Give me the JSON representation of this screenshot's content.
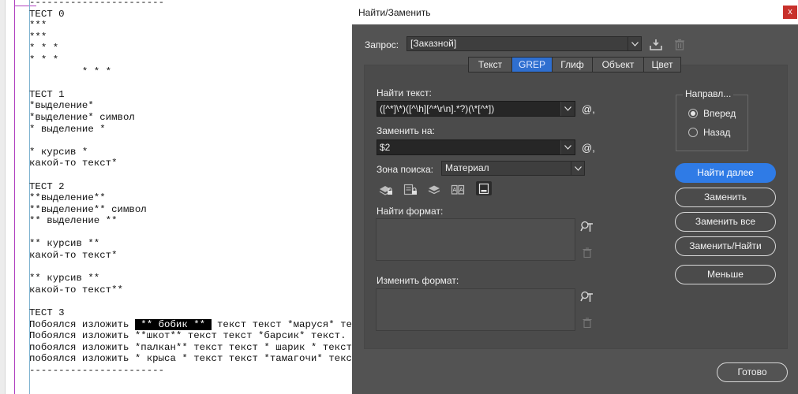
{
  "document": {
    "lines": [
      [
        {
          "t": "-----------------------"
        }
      ],
      [
        {
          "t": "ТЕСТ 0"
        }
      ],
      [
        {
          "t": "***"
        }
      ],
      [
        {
          "t": "***"
        }
      ],
      [
        {
          "t": "* * *"
        }
      ],
      [
        {
          "t": "* * *"
        }
      ],
      [
        {
          "t": "         * * *"
        }
      ],
      [
        {
          "t": ""
        }
      ],
      [
        {
          "t": "ТЕСТ 1"
        }
      ],
      [
        {
          "t": "*выделение*"
        }
      ],
      [
        {
          "t": "*выделение* символ"
        }
      ],
      [
        {
          "t": "* выделение *"
        }
      ],
      [
        {
          "t": ""
        }
      ],
      [
        {
          "t": "* курсив *"
        }
      ],
      [
        {
          "t": "какой-то текст*"
        }
      ],
      [
        {
          "t": ""
        }
      ],
      [
        {
          "t": "ТЕСТ 2"
        }
      ],
      [
        {
          "t": "**выделение**"
        }
      ],
      [
        {
          "t": "**выделение** символ"
        }
      ],
      [
        {
          "t": "** выделение **"
        }
      ],
      [
        {
          "t": ""
        }
      ],
      [
        {
          "t": "** курсив **"
        }
      ],
      [
        {
          "t": "какой-то текст*"
        }
      ],
      [
        {
          "t": ""
        }
      ],
      [
        {
          "t": "** курсив **"
        }
      ],
      [
        {
          "t": "какой-то текст**"
        }
      ],
      [
        {
          "t": ""
        }
      ],
      [
        {
          "t": "ТЕСТ 3"
        }
      ],
      [
        {
          "t": "Побоялся изложить "
        },
        {
          "t": " ** бобик ** ",
          "sel": true
        },
        {
          "t": " текст текст *маруся* текст."
        }
      ],
      [
        {
          "t": "Побоялся изложить **шкот** текст текст *барсик* текст."
        }
      ],
      [
        {
          "t": "побоялся изложить *палкан** текст текст * шарик * текст."
        }
      ],
      [
        {
          "t": "побоялся изложить * крыса * текст текст *тамагочи* текст."
        }
      ],
      [
        {
          "t": "-----------------------"
        }
      ]
    ]
  },
  "dialog": {
    "title": "Найти/Заменить",
    "close_glyph": "x",
    "query": {
      "label": "Запрос:",
      "value": "[Заказной]",
      "icons": [
        "save-query-icon",
        "delete-query-icon"
      ]
    },
    "tabs": [
      {
        "label": "Текст",
        "active": false
      },
      {
        "label": "GREP",
        "active": true
      },
      {
        "label": "Глиф",
        "active": false
      },
      {
        "label": "Объект",
        "active": false
      },
      {
        "label": "Цвет",
        "active": false
      }
    ],
    "find": {
      "label": "Найти текст:",
      "value": "([^*]\\*)([^\\h][^*\\r\\n].*?)(\\*[^*])",
      "special_glyph": "@,"
    },
    "replace": {
      "label": "Заменить на:",
      "value": "$2",
      "special_glyph": "@,"
    },
    "scope": {
      "label": "Зона поиска:",
      "value": "Материал"
    },
    "scope_toolbar": [
      "locked-layers-icon",
      "locked-stories-icon",
      "hidden-layers-icon",
      "master-pages-icon",
      "footnotes-icon"
    ],
    "find_format": {
      "label": "Найти формат:"
    },
    "change_format": {
      "label": "Изменить формат:"
    },
    "direction": {
      "title": "Направл...",
      "options": [
        {
          "label": "Вперед",
          "checked": true
        },
        {
          "label": "Назад",
          "checked": false
        }
      ]
    },
    "buttons": {
      "find_next": "Найти далее",
      "replace": "Заменить",
      "replace_all": "Заменить все",
      "replace_find": "Заменить/Найти",
      "fewer": "Меньше",
      "done": "Готово"
    }
  },
  "colors": {
    "dialog_bg": "#535353",
    "panel_bg": "#4b4b4b",
    "accent": "#2f7be6",
    "active_tab": "#2f6fd0",
    "close_red": "#c8302b"
  }
}
